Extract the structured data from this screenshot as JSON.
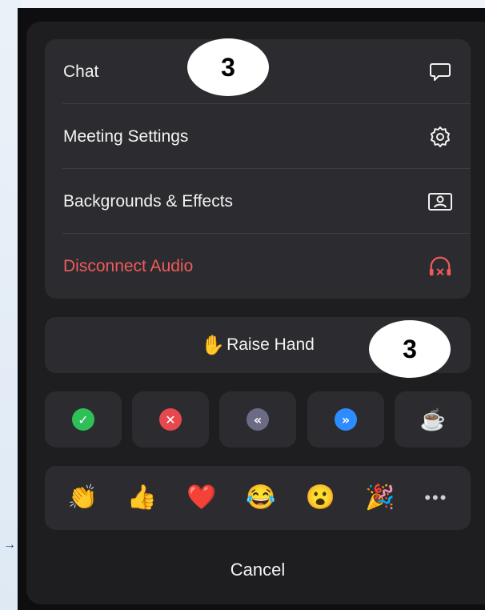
{
  "menu": {
    "items": [
      {
        "label": "Chat",
        "icon": "chat-bubble-icon"
      },
      {
        "label": "Meeting Settings",
        "icon": "gear-icon"
      },
      {
        "label": "Backgrounds & Effects",
        "icon": "portrait-frame-icon"
      },
      {
        "label": "Disconnect Audio",
        "icon": "headphones-disconnect-icon",
        "color": "#f05a5a"
      }
    ]
  },
  "raise_hand": {
    "label": "Raise Hand",
    "emoji": "✋"
  },
  "quick_reactions": [
    {
      "name": "yes-reaction",
      "glyph": "✓",
      "color": "#2fbf58"
    },
    {
      "name": "no-reaction",
      "glyph": "✕",
      "color": "#e5484d"
    },
    {
      "name": "slower-reaction",
      "glyph": "«",
      "color": "#6b6b86"
    },
    {
      "name": "faster-reaction",
      "glyph": "»",
      "color": "#2d8cff"
    },
    {
      "name": "coffee-reaction",
      "glyph": "☕"
    }
  ],
  "emoji_reactions": [
    "👏",
    "👍",
    "❤️",
    "😂",
    "😮",
    "🎉",
    "•••"
  ],
  "cancel_label": "Cancel",
  "annotations": {
    "badge_1": "3",
    "badge_2": "3"
  }
}
